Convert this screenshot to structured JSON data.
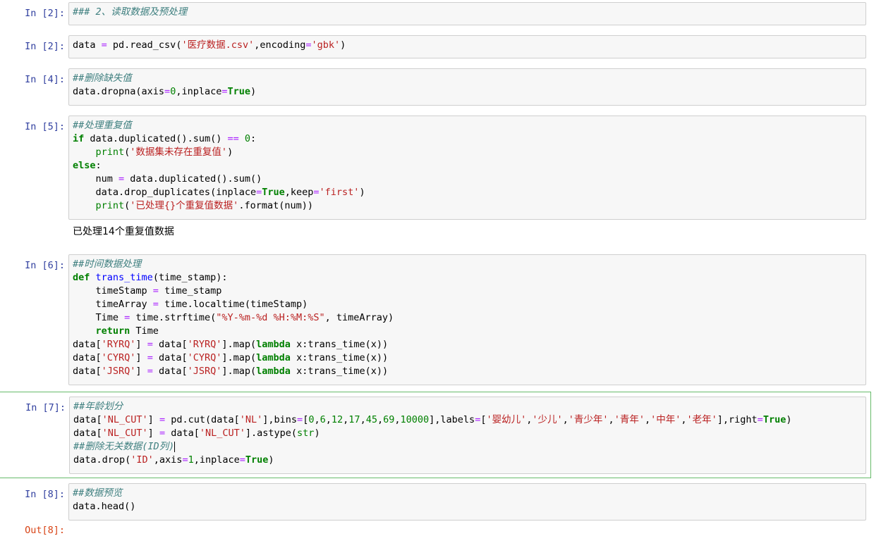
{
  "cells": [
    {
      "prompt": "In  [2]:",
      "lines": [
        "### 2、读取数据及预处理"
      ]
    },
    {
      "prompt": "In  [2]:",
      "lines": [
        "data = pd.read_csv('医疗数据.csv',encoding='gbk')"
      ]
    },
    {
      "prompt": "In  [4]:",
      "lines": [
        "##删除缺失值",
        "data.dropna(axis=0,inplace=True)"
      ]
    },
    {
      "prompt": "In  [5]:",
      "lines": [
        "##处理重复值",
        "if data.duplicated().sum() == 0:",
        "    print('数据集未存在重复值')",
        "else:",
        "    num = data.duplicated().sum()",
        "    data.drop_duplicates(inplace=True,keep='first')",
        "    print('已处理{}个重复值数据'.format(num))"
      ],
      "output": "已处理14个重复值数据"
    },
    {
      "prompt": "In  [6]:",
      "lines": [
        "##时间数据处理",
        "def trans_time(time_stamp):",
        "    timeStamp = time_stamp",
        "    timeArray = time.localtime(timeStamp)",
        "    Time = time.strftime(\"%Y-%m-%d %H:%M:%S\", timeArray)",
        "    return Time",
        "data['RYRQ'] = data['RYRQ'].map(lambda x:trans_time(x))",
        "data['CYRQ'] = data['CYRQ'].map(lambda x:trans_time(x))",
        "data['JSRQ'] = data['JSRQ'].map(lambda x:trans_time(x))"
      ]
    },
    {
      "prompt": "In  [7]:",
      "lines": [
        "##年龄划分",
        "data['NL_CUT'] = pd.cut(data['NL'],bins=[0,6,12,17,45,69,10000],labels=['婴幼儿','少儿','青少年','青年','中年','老年'],right=True)",
        "data['NL_CUT'] = data['NL_CUT'].astype(str)",
        "##删除无关数据(ID列)",
        "data.drop('ID',axis=1,inplace=True)"
      ]
    },
    {
      "prompt": "In  [8]:",
      "lines": [
        "##数据预览",
        "data.head()"
      ]
    }
  ],
  "out_prompt": "Out[8]:"
}
